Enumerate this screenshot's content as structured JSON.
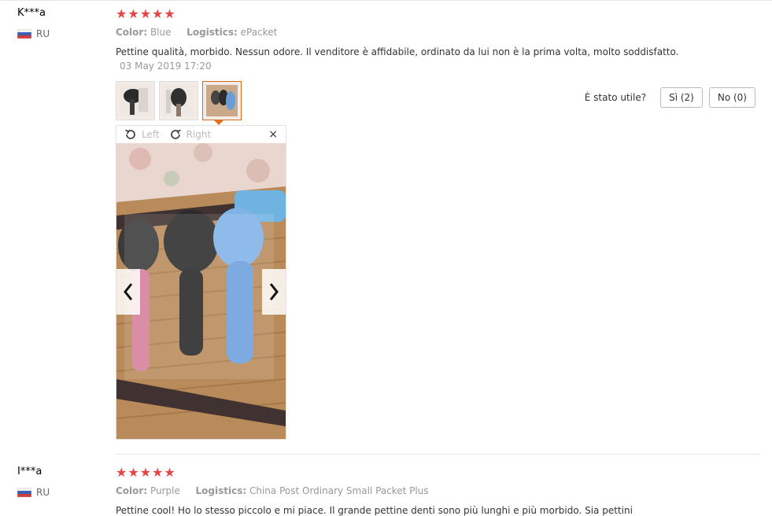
{
  "reviews": [
    {
      "user": "K***a",
      "country": "RU",
      "stars": "★★★★★",
      "color_label": "Color:",
      "color_value": "Blue",
      "logistics_label": "Logistics:",
      "logistics_value": "ePacket",
      "text": "Pettine qualità, morbido. Nessun odore. Il venditore è affidabile, ordinato da lui non è la prima volta, molto soddisfatto.",
      "date": "03 May 2019 17:20",
      "useful_question": "È stato utile?",
      "yes_label": "Sì (2)",
      "no_label": "No (0)",
      "viewer": {
        "rotate_left": "Left",
        "rotate_right": "Right",
        "close": "×"
      }
    },
    {
      "user": "I***a",
      "country": "RU",
      "stars": "★★★★★",
      "color_label": "Color:",
      "color_value": "Purple",
      "logistics_label": "Logistics:",
      "logistics_value": "China Post Ordinary Small Packet Plus",
      "text": "Pettine cool! Ho lo stesso piccolo e mi piace. Il grande pettine denti sono più lunghi e più morbido. Sia pettini"
    }
  ],
  "colors": {
    "star": "#e64545",
    "accent": "#d86a1a"
  },
  "icons": [
    "flag-ru-icon",
    "rotate-left-icon",
    "rotate-right-icon",
    "close-icon",
    "chevron-left-icon",
    "chevron-right-icon"
  ]
}
